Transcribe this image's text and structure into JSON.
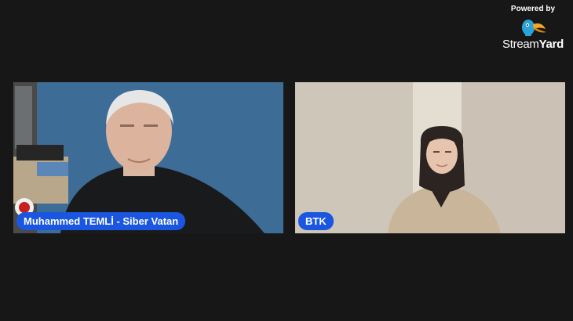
{
  "branding": {
    "powered_by": "Powered by",
    "name_part1": "Stream",
    "name_part2": "Yard"
  },
  "participants": [
    {
      "name": "Muhammed TEMLİ - Siber Vatan"
    },
    {
      "name": "BTK"
    }
  ],
  "colors": {
    "background": "#171717",
    "name_tag": "#1a56e0"
  }
}
